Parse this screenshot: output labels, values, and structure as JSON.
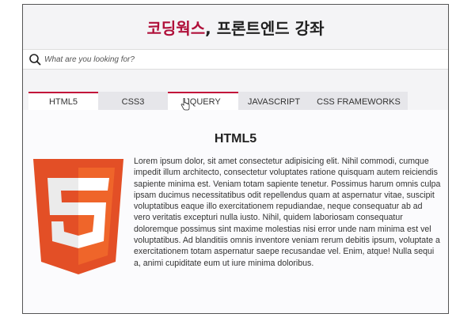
{
  "header": {
    "title_accent": "코딩웍스",
    "title_rest": ", 프론트엔드 강좌"
  },
  "search": {
    "icon": "search-icon",
    "placeholder": "What are you looking for?"
  },
  "tabs": [
    {
      "label": "HTML5",
      "active": true
    },
    {
      "label": "CSS3",
      "active": false
    },
    {
      "label": "JQUERY",
      "active": true
    },
    {
      "label": "JAVASCRIPT",
      "active": false
    },
    {
      "label": "CSS FRAMEWORKS",
      "active": false
    }
  ],
  "content": {
    "heading": "HTML5",
    "logo": "html5-logo",
    "paragraph": "Lorem ipsum dolor, sit amet consectetur adipisicing elit. Nihil commodi, cumque impedit illum architecto, consectetur voluptates ratione quisquam autem reiciendis sapiente minima est. Veniam totam sapiente tenetur. Possimus harum omnis culpa ipsam ducimus necessitatibus odit repellendus quam at aspernatur vitae, suscipit voluptatibus eaque illo exercitationem repudiandae, neque consequatur ab ad vero veritatis excepturi nulla iusto. Nihil, quidem laboriosam consequatur doloremque possimus sint maxime molestias nisi error unde nam minima est vel voluptatibus. Ad blanditiis omnis inventore veniam rerum debitis ipsum, voluptate a exercitationem totam aspernatur saepe recusandae vel. Enim, atque! Nulla sequi a, animi cupiditate eum ut iure minima doloribus."
  },
  "colors": {
    "accent": "#b0103a",
    "tab_active_border": "#c2103a",
    "logo_dark": "#e34f26",
    "logo_light": "#ef652a"
  }
}
